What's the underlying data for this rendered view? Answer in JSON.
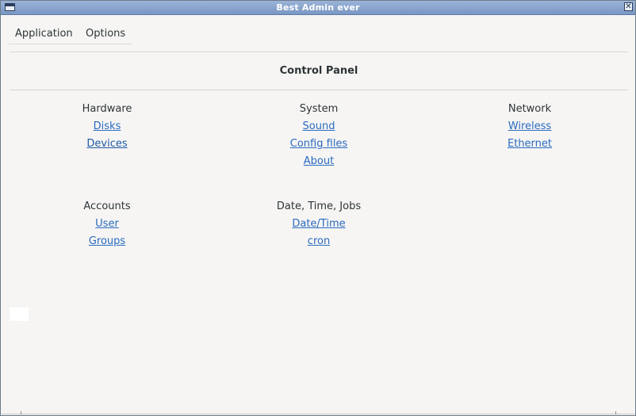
{
  "window": {
    "title": "Best Admin ever",
    "close_glyph": "✕"
  },
  "menubar": {
    "items": [
      "Application",
      "Options"
    ]
  },
  "panel": {
    "title": "Control Panel"
  },
  "groups": [
    {
      "heading": "Hardware",
      "links": [
        " Disks",
        " Devices"
      ]
    },
    {
      "heading": "System",
      "links": [
        " Sound",
        " Config files",
        " About"
      ]
    },
    {
      "heading": "Network",
      "links": [
        " Wireless",
        " Ethernet"
      ]
    },
    {
      "heading": "Accounts",
      "links": [
        " User",
        " Groups"
      ]
    },
    {
      "heading": "Date, Time, Jobs",
      "links": [
        " Date/Time",
        " cron"
      ]
    }
  ],
  "colors": {
    "titlebar": "#7a97c4",
    "link": "#2a6bbf",
    "background": "#f6f5f4"
  }
}
